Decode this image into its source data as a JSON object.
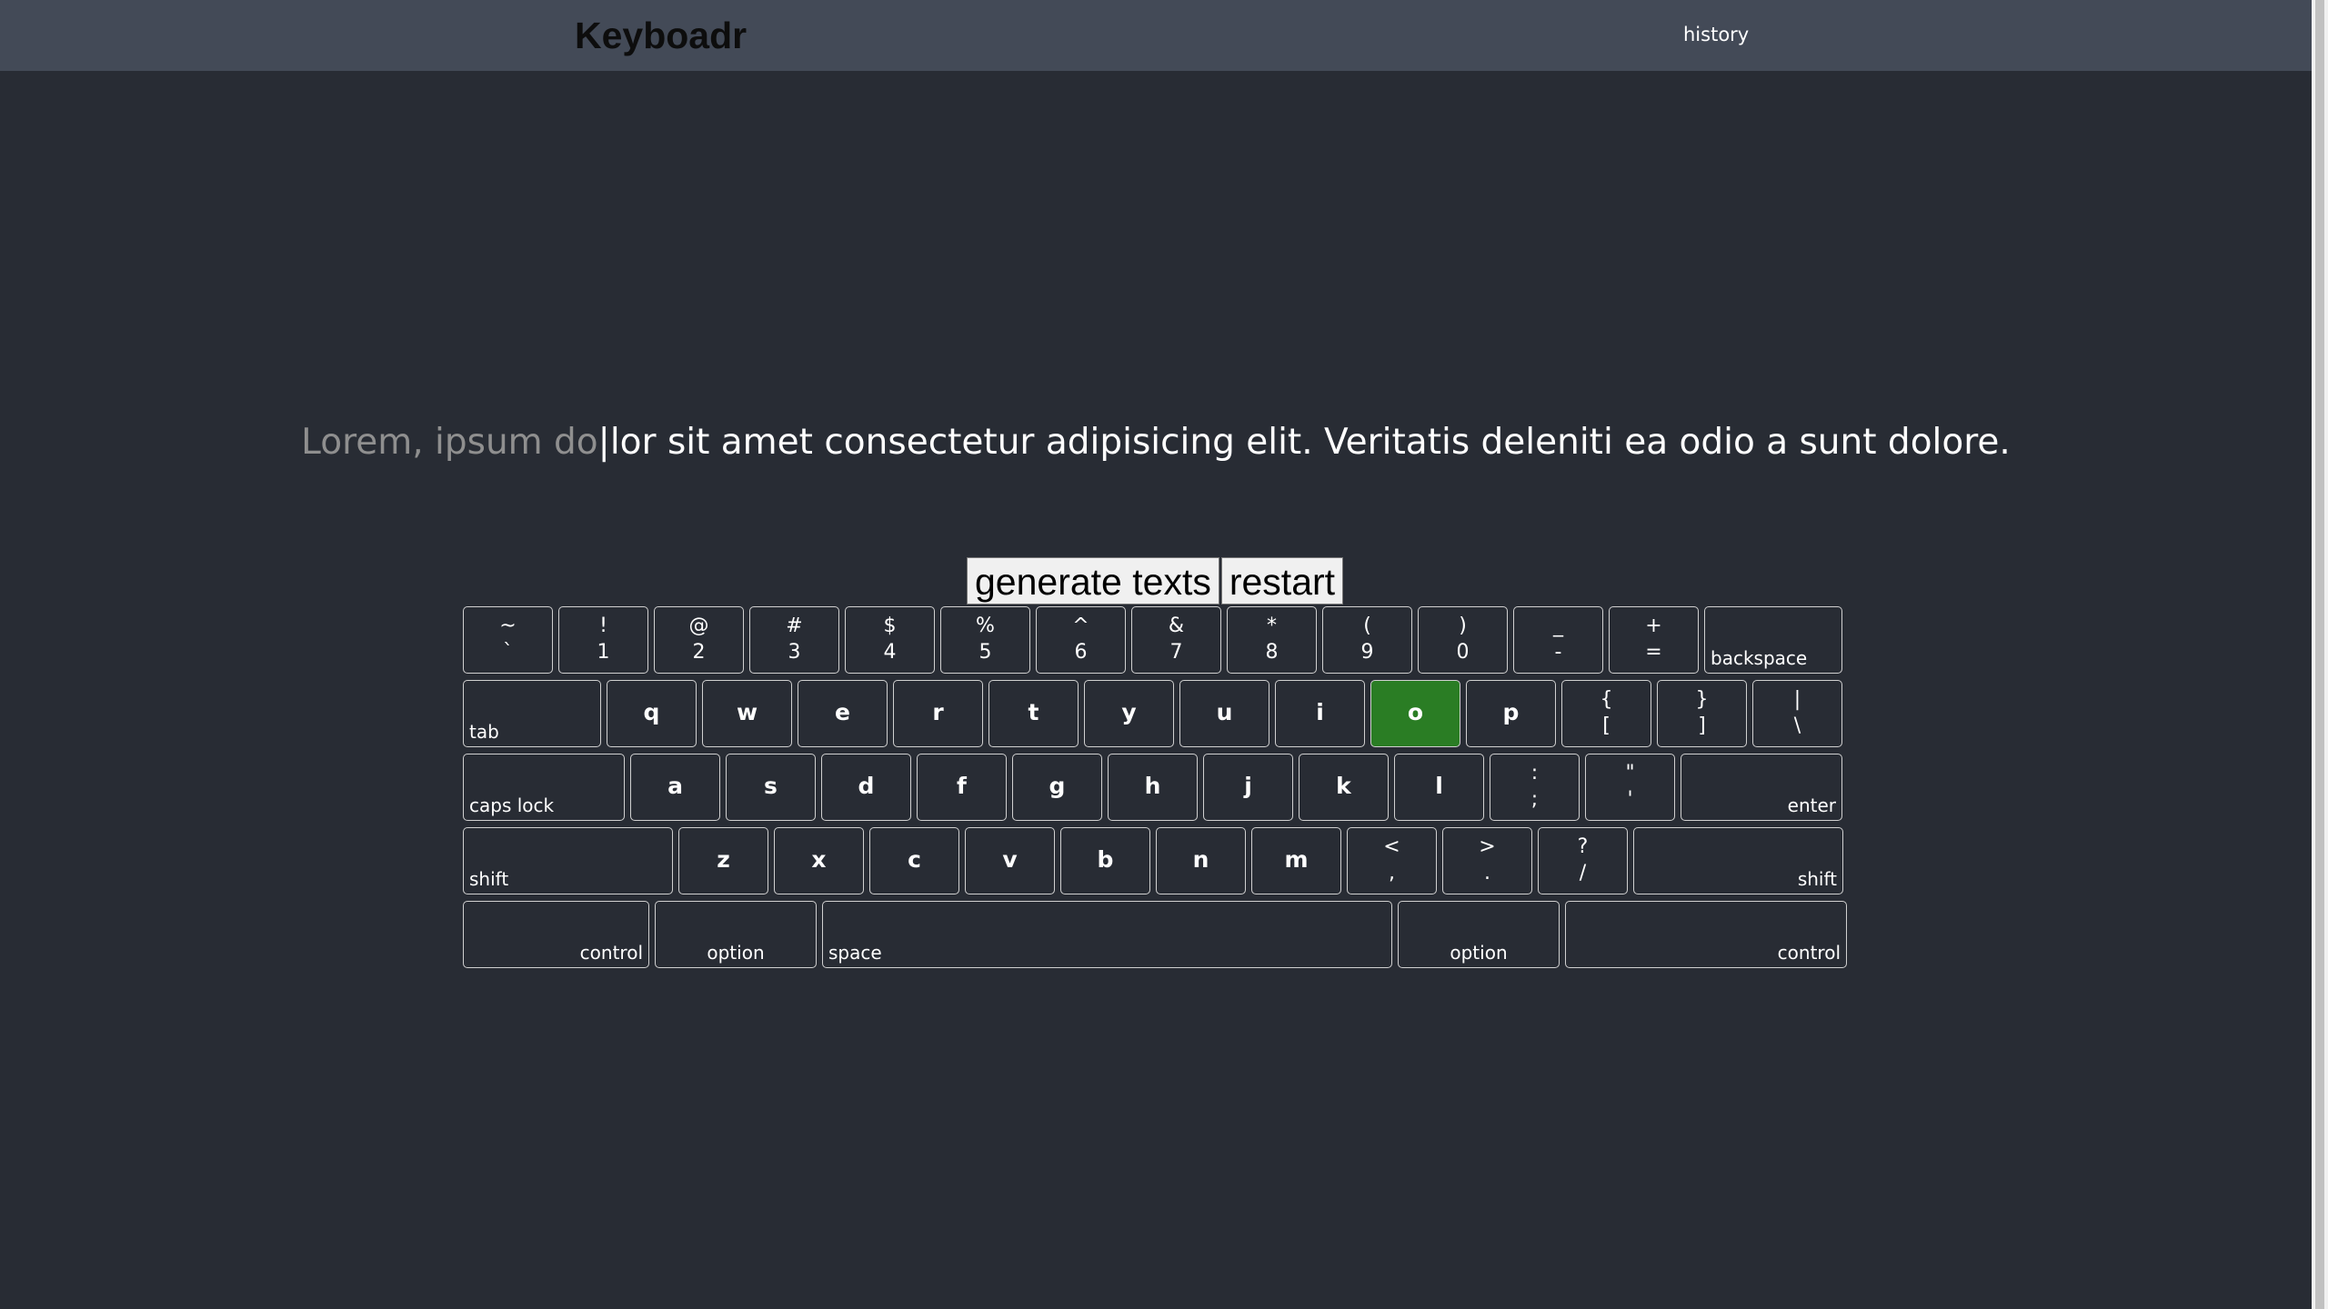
{
  "header": {
    "brand": "Keyboadr",
    "nav_history": "history"
  },
  "text": {
    "typed": "Lorem, ipsum do",
    "caret": "|",
    "remaining": "lor sit amet consectetur adipisicing elit. Veritatis deleniti ea odio a sunt dolore."
  },
  "actions": {
    "generate": "generate texts",
    "restart": "restart"
  },
  "colors": {
    "background": "#282c34",
    "navbar": "#434a57",
    "active_key": "#2a7d24",
    "typed_text": "#8f8f8f"
  },
  "keyboard": {
    "active_key": "o",
    "rows": [
      [
        {
          "top": "~",
          "bottom": "`"
        },
        {
          "top": "!",
          "bottom": "1"
        },
        {
          "top": "@",
          "bottom": "2"
        },
        {
          "top": "#",
          "bottom": "3"
        },
        {
          "top": "$",
          "bottom": "4"
        },
        {
          "top": "%",
          "bottom": "5"
        },
        {
          "top": "^",
          "bottom": "6"
        },
        {
          "top": "&",
          "bottom": "7"
        },
        {
          "top": "*",
          "bottom": "8"
        },
        {
          "top": "(",
          "bottom": "9"
        },
        {
          "top": ")",
          "bottom": "0"
        },
        {
          "top": "_",
          "bottom": "-"
        },
        {
          "top": "+",
          "bottom": "="
        },
        {
          "label": "backspace"
        }
      ],
      [
        {
          "label": "tab"
        },
        {
          "main": "q"
        },
        {
          "main": "w"
        },
        {
          "main": "e"
        },
        {
          "main": "r"
        },
        {
          "main": "t"
        },
        {
          "main": "y"
        },
        {
          "main": "u"
        },
        {
          "main": "i"
        },
        {
          "main": "o"
        },
        {
          "main": "p"
        },
        {
          "top": "{",
          "bottom": "["
        },
        {
          "top": "}",
          "bottom": "]"
        },
        {
          "top": "|",
          "bottom": "\\"
        }
      ],
      [
        {
          "label": "caps lock"
        },
        {
          "main": "a"
        },
        {
          "main": "s"
        },
        {
          "main": "d"
        },
        {
          "main": "f"
        },
        {
          "main": "g"
        },
        {
          "main": "h"
        },
        {
          "main": "j"
        },
        {
          "main": "k"
        },
        {
          "main": "l"
        },
        {
          "top": ":",
          "bottom": ";"
        },
        {
          "top": "\"",
          "bottom": "'"
        },
        {
          "label": "enter"
        }
      ],
      [
        {
          "label": "shift"
        },
        {
          "main": "z"
        },
        {
          "main": "x"
        },
        {
          "main": "c"
        },
        {
          "main": "v"
        },
        {
          "main": "b"
        },
        {
          "main": "n"
        },
        {
          "main": "m"
        },
        {
          "top": "<",
          "bottom": ","
        },
        {
          "top": ">",
          "bottom": "."
        },
        {
          "top": "?",
          "bottom": "/"
        },
        {
          "label": "shift"
        }
      ],
      [
        {
          "label": "control"
        },
        {
          "label": "option"
        },
        {
          "label": "space"
        },
        {
          "label": "option"
        },
        {
          "label": "control"
        }
      ]
    ]
  }
}
